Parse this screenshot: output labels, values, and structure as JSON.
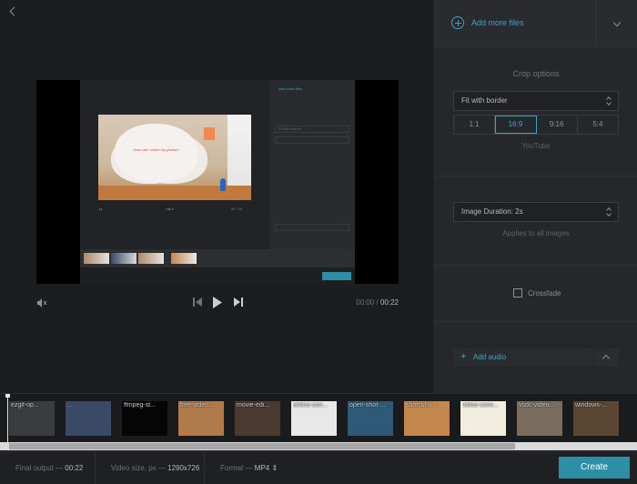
{
  "nav": {
    "back_icon": "chevron-left-icon"
  },
  "preview": {
    "frame_caption": "How can I share my photos?",
    "mini_panel_label": "Add more files",
    "mini_select": "Fit with border",
    "mini_merge_label": "Merge"
  },
  "player": {
    "current_time": "00:00",
    "separator": "/",
    "total_time": "00:22",
    "mute_icon": "speaker-muted-icon",
    "prev_icon": "skip-back-icon",
    "play_icon": "play-icon",
    "next_icon": "skip-forward-icon"
  },
  "panel": {
    "add_more_files": "Add more files",
    "crop_title": "Crop options",
    "crop_mode": "Fit with border",
    "ratios": [
      "1:1",
      "16:9",
      "9:16",
      "5:4"
    ],
    "selected_ratio": "16:9",
    "ratio_hint": "YouTube",
    "image_duration": "Image Duration: 2s",
    "duration_hint": "Applies to all images",
    "crossfade_label": "Crossfade",
    "crossfade_checked": false,
    "add_audio": "Add audio"
  },
  "timeline": {
    "thumbs": [
      {
        "caption": "ezgif-op...",
        "bg": "#3b3c40"
      },
      {
        "caption": "...",
        "bg": "#3a4a66"
      },
      {
        "caption": "ffmpeg-st...",
        "bg": "#050505"
      },
      {
        "caption": "free-video...",
        "bg": "#b07a4a"
      },
      {
        "caption": "movie-edi...",
        "bg": "#4a3a30"
      },
      {
        "caption": "online-con...",
        "bg": "#e8e8e8"
      },
      {
        "caption": "open-shot-...",
        "bg": "#2e5a78"
      },
      {
        "caption": "shotcut-v...",
        "bg": "#c4874c"
      },
      {
        "caption": "video-conv...",
        "bg": "#f1eee0"
      },
      {
        "caption": "vsdc-video...",
        "bg": "#7a6c5e"
      },
      {
        "caption": "windows-...",
        "bg": "#5a4632"
      }
    ]
  },
  "footer": {
    "final_output_label": "Final output —",
    "final_output_value": "00:22",
    "video_size_label": "Video size, px —",
    "video_size_value": "1290x726",
    "format_label": "Format —",
    "format_value": "MP4",
    "create_label": "Create"
  },
  "colors": {
    "accent": "#3aa6c2",
    "create_button": "#2d8fa7"
  }
}
